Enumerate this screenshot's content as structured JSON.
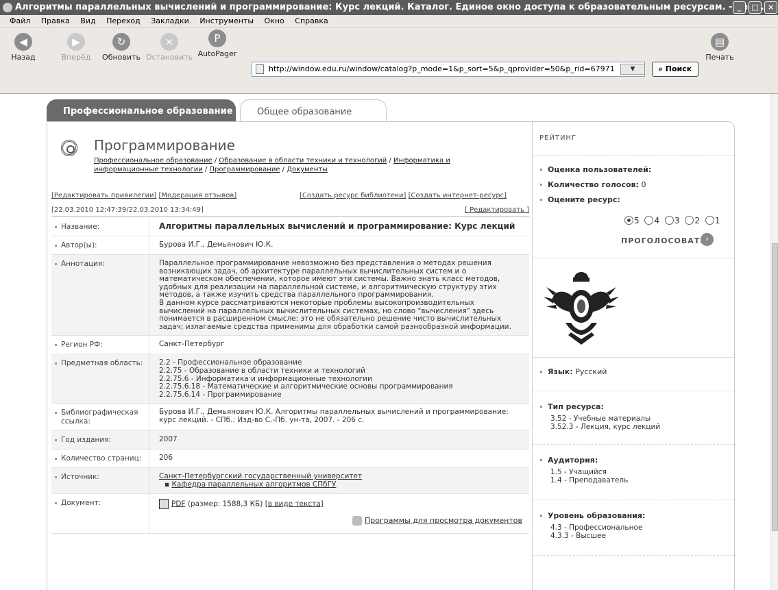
{
  "window": {
    "title": "Алгоритмы параллельных вычислений и программирование: Курс лекций. Каталог. Единое окно доступа к образовательным ресурсам. - Sea..."
  },
  "menu": [
    "Файл",
    "Правка",
    "Вид",
    "Переход",
    "Закладки",
    "Инструменты",
    "Окно",
    "Справка"
  ],
  "toolbar": {
    "back": "Назад",
    "forward": "Вперёд",
    "reload": "Обновить",
    "stop": "Остановить",
    "autopager": "AutoPager",
    "search": "Поиск",
    "print": "Печать",
    "url": "http://window.edu.ru/window/catalog?p_mode=1&p_sort=5&p_qprovider=50&p_rid=67971"
  },
  "tabs": {
    "active": "Профессиональное образование",
    "inactive": "Общее образование"
  },
  "category": {
    "title": "Программирование",
    "path": [
      "Профессиональное образование",
      "Образование в области техники и технологий",
      "Информатика и информационные технологии",
      "Программирование",
      "Документы"
    ]
  },
  "admin": {
    "edit_priv": "[Редактировать привилегии]",
    "moderate": "[Модерация отзывов]",
    "create_lib": "[Создать ресурс библиотеки]",
    "create_net": "[Создать интернет-ресурс]",
    "dates": "[22.03.2010 12:47:39/22.03.2010 13:34:49]",
    "edit": "[ Редактировать ]"
  },
  "rows": [
    {
      "k": "Название:",
      "v": "Алгоритмы параллельных вычислений и программирование: Курс лекций"
    },
    {
      "k": "Автор(ы):",
      "v": "Бурова И.Г., Демьянович Ю.К."
    },
    {
      "k": "Аннотация:",
      "v": "Параллельное программирование невозможно без представления о методах решения возникающих задач, об архитектуре параллельных вычислительных систем и о математическом обеспечении, которое имеют эти системы. Важно знать класс методов, удобных для реализации на параллельной системе, и алгоритмическую структуру этих методов, а также изучить средства параллельного программирования."
    },
    {
      "k": "Аннотация2",
      "v": "В данном курсе рассматриваются некоторые проблемы высокопроизводительных вычислений на параллельных вычислительных системах, но слово \"вычисления\" здесь понимается в расширенном смысле: это не обязательно решение чисто вычислительных задач; излагаемые средства применимы для обработки самой разнообразной информации."
    },
    {
      "k": "Регион РФ:",
      "v": "Санкт-Петербург"
    },
    {
      "k": "Предметная область:",
      "v": [
        "2.2 - Профессиональное образование",
        "2.2.75 - Образование в области техники и технологий",
        "2.2.75.6 - Информатика и информационные технологии",
        "2.2.75.6.18 - Математические и алгоритмические основы программирования",
        "2.2.75.6.14 - Программирование"
      ]
    },
    {
      "k": "Библиографическая ссылка:",
      "v": "Бурова И.Г., Демьянович Ю.К. Алгоритмы параллельных вычислений и программирование: курс лекций. - СПб.: Изд-во С.-Пб. ун-та, 2007. - 206 с."
    },
    {
      "k": "Год издания:",
      "v": "2007"
    },
    {
      "k": "Количество страниц:",
      "v": "206"
    },
    {
      "k": "Источник:",
      "v": "Санкт-Петербургский государственный университет",
      "sub": "Кафедра параллельных алгоритмов СПбГУ"
    },
    {
      "k": "Документ:",
      "pdf": "PDF",
      "size": "(размер: 1588,3 КБ)",
      "text": "[в виде текста]",
      "viewers": "Программы для просмотра документов"
    }
  ],
  "rating": {
    "head": "РЕЙТИНГ",
    "user": "Оценка пользователей:",
    "votes_label": "Количество голосов:",
    "votes": "0",
    "rate": "Оцените ресурс:",
    "options": [
      "5",
      "4",
      "3",
      "2",
      "1"
    ],
    "selected": "5",
    "vote": "ПРОГОЛОСОВАТЬ"
  },
  "meta": {
    "lang_label": "Язык:",
    "lang": "Русский",
    "type_label": "Тип ресурса:",
    "type": [
      "3.52 - Учебные материалы",
      "3.52.3 - Лекция, курс лекций"
    ],
    "aud_label": "Аудитория:",
    "aud": [
      "1.5 - Учащийся",
      "1.4 - Преподаватель"
    ],
    "level_label": "Уровень образования:",
    "level": [
      "4.3 - Профессиональное",
      "4.3.3 - Высшее"
    ]
  },
  "colors": {
    "tab_active": "#6a6a6a",
    "titlebar": "#5a5a5a",
    "menubar": "#ece9e5"
  }
}
